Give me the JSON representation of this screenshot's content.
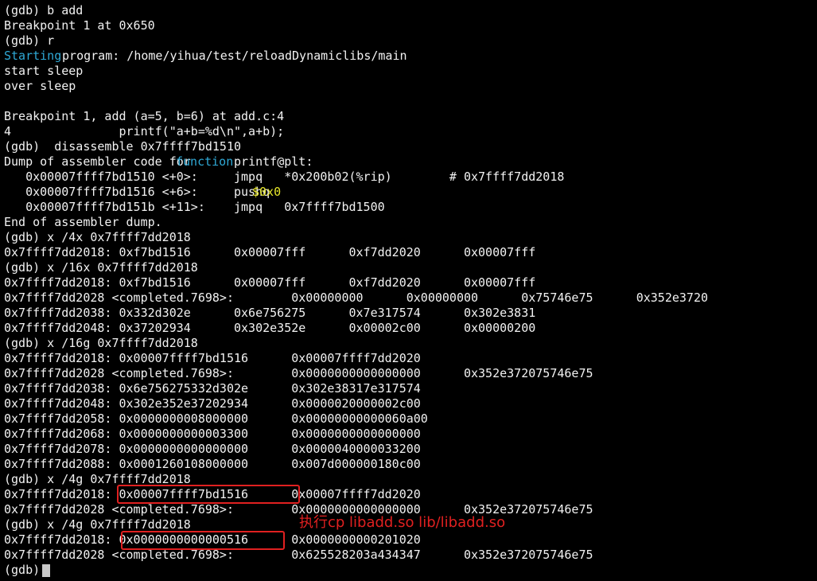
{
  "terminal": {
    "lines": [
      {
        "segments": [
          {
            "text": "(gdb) b add"
          }
        ]
      },
      {
        "segments": [
          {
            "text": "Breakpoint 1 at 0x650"
          }
        ]
      },
      {
        "segments": [
          {
            "text": "(gdb) r"
          }
        ]
      },
      {
        "segments": [
          {
            "text": "Starting",
            "color": "cyan"
          },
          {
            "text": " program: /home/yihua/test/reloadDynamiclibs/main"
          }
        ]
      },
      {
        "segments": [
          {
            "text": "start sleep"
          }
        ]
      },
      {
        "segments": [
          {
            "text": "over sleep"
          }
        ]
      },
      {
        "segments": [
          {
            "text": ""
          }
        ]
      },
      {
        "segments": [
          {
            "text": "Breakpoint 1, add (a=5, b=6) at add.c:4"
          }
        ]
      },
      {
        "segments": [
          {
            "text": "4               printf(\"a+b=%d\\n\",a+b);"
          }
        ]
      },
      {
        "segments": [
          {
            "text": "(gdb)  disassemble 0x7ffff7bd1510"
          }
        ]
      },
      {
        "segments": [
          {
            "text": "Dump of assembler code for "
          },
          {
            "text": "function",
            "color": "cyan"
          },
          {
            "text": " printf@plt:"
          }
        ]
      },
      {
        "segments": [
          {
            "text": "   0x00007ffff7bd1510 <+0>:     jmpq   *0x200b02(%rip)        # 0x7ffff7dd2018"
          }
        ]
      },
      {
        "segments": [
          {
            "text": "   0x00007ffff7bd1516 <+6>:     pushq  "
          },
          {
            "text": "$0x0",
            "color": "yellow"
          }
        ]
      },
      {
        "segments": [
          {
            "text": "   0x00007ffff7bd151b <+11>:    jmpq   0x7ffff7bd1500"
          }
        ]
      },
      {
        "segments": [
          {
            "text": "End of assembler dump."
          }
        ]
      },
      {
        "segments": [
          {
            "text": "(gdb) x /4x 0x7ffff7dd2018"
          }
        ]
      },
      {
        "segments": [
          {
            "text": "0x7ffff7dd2018: 0xf7bd1516      0x00007fff      0xf7dd2020      0x00007fff"
          }
        ]
      },
      {
        "segments": [
          {
            "text": "(gdb) x /16x 0x7ffff7dd2018"
          }
        ]
      },
      {
        "segments": [
          {
            "text": "0x7ffff7dd2018: 0xf7bd1516      0x00007fff      0xf7dd2020      0x00007fff"
          }
        ]
      },
      {
        "segments": [
          {
            "text": "0x7ffff7dd2028 <completed.7698>:        0x00000000      0x00000000      0x75746e75      0x352e3720"
          }
        ]
      },
      {
        "segments": [
          {
            "text": "0x7ffff7dd2038: 0x332d302e      0x6e756275      0x7e317574      0x302e3831"
          }
        ]
      },
      {
        "segments": [
          {
            "text": "0x7ffff7dd2048: 0x37202934      0x302e352e      0x00002c00      0x00000200"
          }
        ]
      },
      {
        "segments": [
          {
            "text": "(gdb) x /16g 0x7ffff7dd2018"
          }
        ]
      },
      {
        "segments": [
          {
            "text": "0x7ffff7dd2018: 0x00007ffff7bd1516      0x00007ffff7dd2020"
          }
        ]
      },
      {
        "segments": [
          {
            "text": "0x7ffff7dd2028 <completed.7698>:        0x0000000000000000      0x352e372075746e75"
          }
        ]
      },
      {
        "segments": [
          {
            "text": "0x7ffff7dd2038: 0x6e756275332d302e      0x302e38317e317574"
          }
        ]
      },
      {
        "segments": [
          {
            "text": "0x7ffff7dd2048: 0x302e352e37202934      0x0000020000002c00"
          }
        ]
      },
      {
        "segments": [
          {
            "text": "0x7ffff7dd2058: 0x0000000008000000      0x00000000000060a00"
          }
        ]
      },
      {
        "segments": [
          {
            "text": "0x7ffff7dd2068: 0x0000000000003300      0x0000000000000000"
          }
        ]
      },
      {
        "segments": [
          {
            "text": "0x7ffff7dd2078: 0x0000000000000000      0x0000040000033200"
          }
        ]
      },
      {
        "segments": [
          {
            "text": "0x7ffff7dd2088: 0x0001260108000000      0x007d000000180c00"
          }
        ]
      },
      {
        "segments": [
          {
            "text": "(gdb) x /4g 0x7ffff7dd2018"
          }
        ]
      },
      {
        "segments": [
          {
            "text": "0x7ffff7dd2018: 0x00007ffff7bd1516      0x00007ffff7dd2020"
          }
        ]
      },
      {
        "segments": [
          {
            "text": "0x7ffff7dd2028 <completed.7698>:        0x0000000000000000      0x352e372075746e75"
          }
        ]
      },
      {
        "segments": [
          {
            "text": "(gdb) x /4g 0x7ffff7dd2018"
          }
        ]
      },
      {
        "segments": [
          {
            "text": "0x7ffff7dd2018: 0x0000000000000516      0x0000000000201020"
          }
        ]
      },
      {
        "segments": [
          {
            "text": "0x7ffff7dd2028 <completed.7698>:        0x625528203a434347      0x352e372075746e75"
          }
        ]
      },
      {
        "segments": [
          {
            "text": "(gdb) "
          }
        ]
      }
    ],
    "annotation": "执行cp libadd.so lib/libadd.so",
    "colors": {
      "background": "#000000",
      "text": "#f2f2f2",
      "cyan": "#2fa9d6",
      "yellow": "#e6e62a",
      "highlight": "#e02020"
    }
  }
}
